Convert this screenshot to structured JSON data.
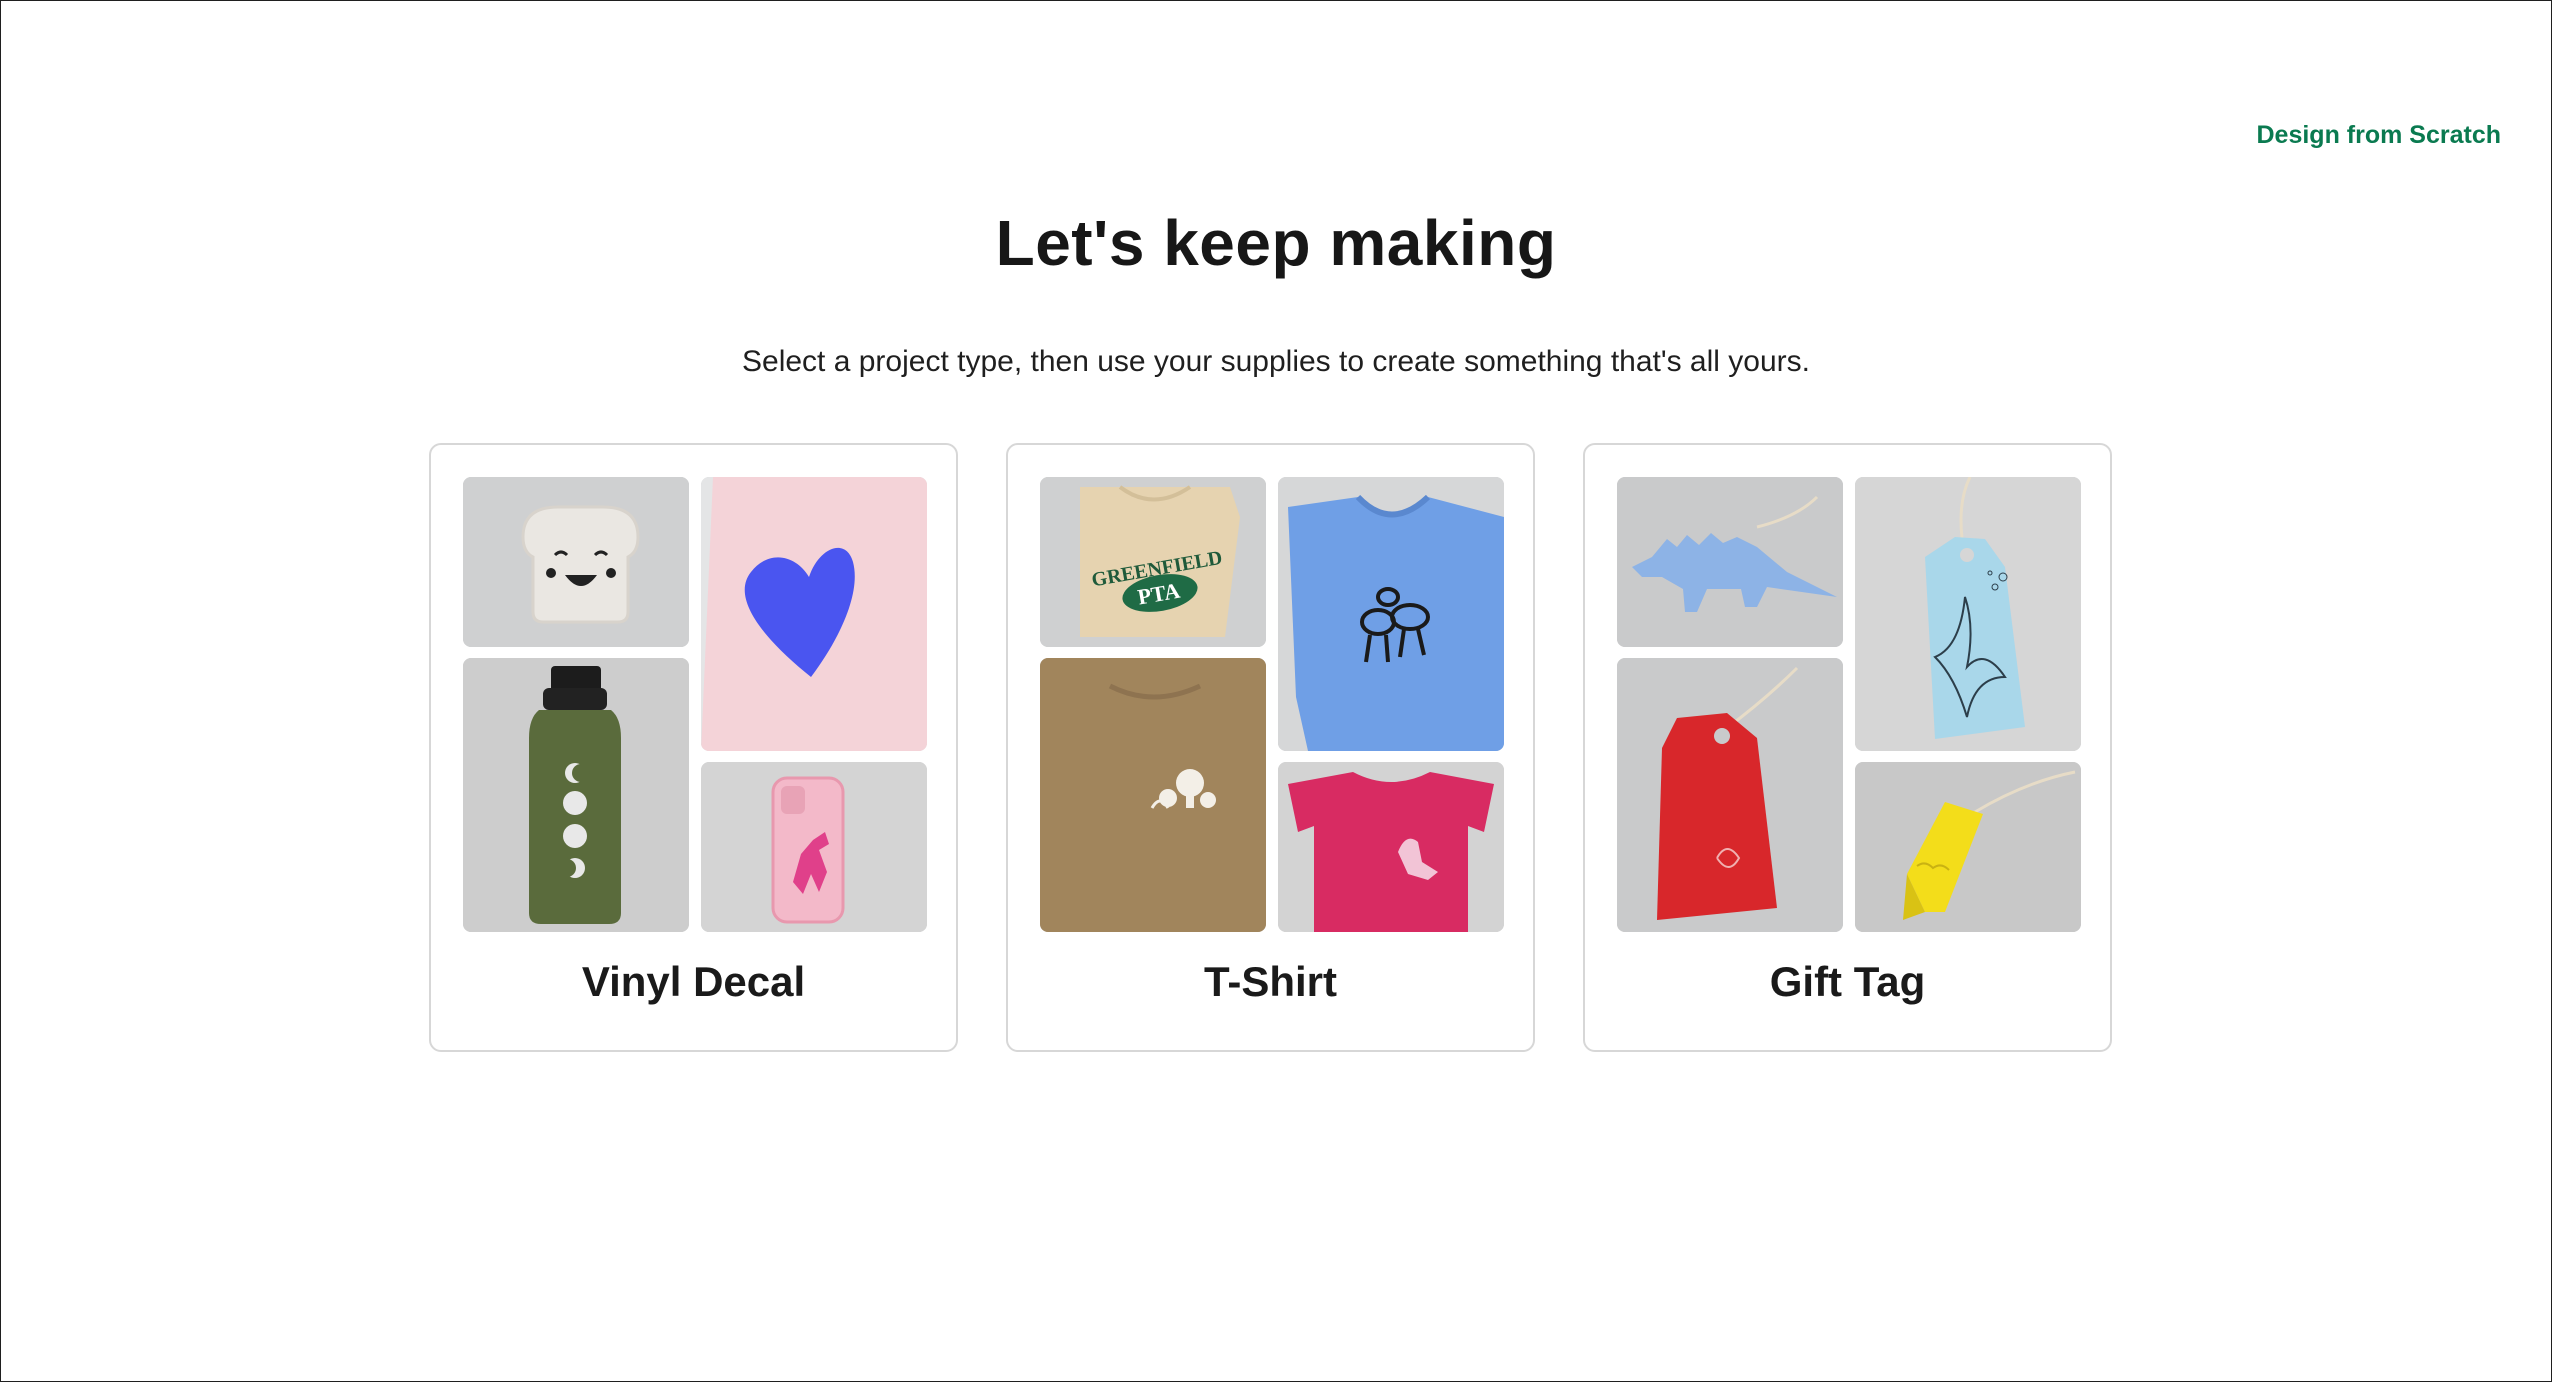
{
  "header": {
    "scratch_link": "Design from Scratch",
    "title": "Let's keep making",
    "subtitle": "Select a project type, then use your supplies to create something that's all yours."
  },
  "cards": [
    {
      "label": "Vinyl Decal"
    },
    {
      "label": "T-Shirt",
      "shirt_print": {
        "line1": "GREENFIELD",
        "line2": "PTA"
      }
    },
    {
      "label": "Gift Tag"
    }
  ],
  "colors": {
    "accent_green": "#0a7a50",
    "card_border": "#d7d7d7"
  }
}
